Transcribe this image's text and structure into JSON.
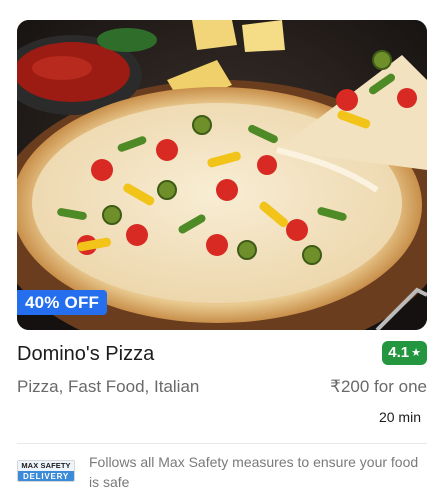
{
  "restaurant": {
    "name": "Domino's Pizza",
    "rating": "4.1",
    "rating_star": "★",
    "cuisines": "Pizza, Fast Food, Italian",
    "cost": "₹200 for one",
    "delivery_time": "20 min",
    "offer": "40% OFF"
  },
  "safety": {
    "logo_top": "MAX SAFETY",
    "logo_bottom": "DELIVERY",
    "message": "Follows all Max Safety measures to ensure your food is safe"
  },
  "colors": {
    "offer_blue": "#256fef",
    "rating_green": "#24963f"
  }
}
